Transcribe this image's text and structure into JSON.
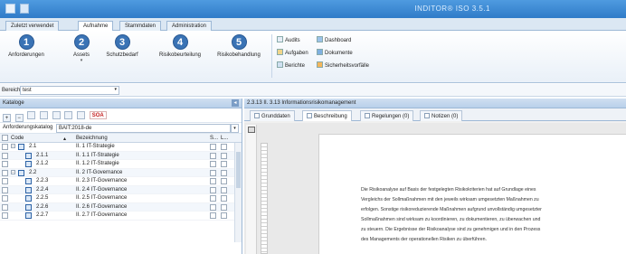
{
  "app": {
    "title": "INDITOR® ISO 3.5.1"
  },
  "ribbon_tabs": [
    {
      "label": "Zuletzt verwendet",
      "active": false
    },
    {
      "label": "Aufnahme",
      "active": true
    },
    {
      "label": "Stammdaten",
      "active": false
    },
    {
      "label": "Administration",
      "active": false
    }
  ],
  "ribbon": {
    "steps": [
      {
        "number": "1",
        "label": "Anforderungen"
      },
      {
        "number": "2",
        "label": "Assets"
      },
      {
        "number": "3",
        "label": "Schutzbedarf"
      },
      {
        "number": "4",
        "label": "Risikobeurteilung"
      },
      {
        "number": "5",
        "label": "Risikobehandlung"
      }
    ],
    "links_col1": [
      "Audits",
      "Aufgaben",
      "Berichte"
    ],
    "links_col2": [
      "Dashboard",
      "Dokumente",
      "Sicherheitsvorfälle"
    ],
    "accent_color": "#3a73b5"
  },
  "bereich": {
    "label": "Bereich",
    "value": "test"
  },
  "kataloge": {
    "title": "Kataloge",
    "soa_label": "SOA",
    "katalog_label": "Anforderungskatalog",
    "katalog_value": "BAIT:2018-de",
    "columns": {
      "code": "Code",
      "bezeichnung": "Bezeichnung",
      "s": "S...",
      "l": "L..."
    },
    "rows": [
      {
        "code": "2.1",
        "name": "II. 1 IT-Strategie",
        "level": 0
      },
      {
        "code": "2.1.1",
        "name": "II. 1.1 IT-Strategie",
        "level": 1
      },
      {
        "code": "2.1.2",
        "name": "II. 1.2 IT-Strategie",
        "level": 1
      },
      {
        "code": "2.2",
        "name": "II. 2 IT-Governance",
        "level": 0
      },
      {
        "code": "2.2.3",
        "name": "II. 2.3 IT-Governance",
        "level": 1
      },
      {
        "code": "2.2.4",
        "name": "II. 2.4 IT-Governance",
        "level": 1
      },
      {
        "code": "2.2.5",
        "name": "II. 2.5 IT-Governance",
        "level": 1
      },
      {
        "code": "2.2.6",
        "name": "II. 2.6 IT-Governance",
        "level": 1
      },
      {
        "code": "2.2.7",
        "name": "II. 2.7 IT-Governance",
        "level": 1
      }
    ]
  },
  "detail": {
    "title": "2.3.13 II. 3.13 Informationsrisikomanagement",
    "tabs": [
      {
        "label": "Grunddaten",
        "active": false
      },
      {
        "label": "Beschreibung",
        "active": true
      },
      {
        "label": "Regelungen (0)",
        "active": false
      },
      {
        "label": "Notizen (0)",
        "active": false
      }
    ],
    "body_lines": [
      "Die Risikoanalyse auf Basis der festgelegten Risikokriterien hat auf Grundlage eines",
      "Vergleichs der Sollmaßnahmen mit den jeweils wirksam umgesetzten Maßnahmen zu",
      "erfolgen. Sonstige risikoreduzierende Maßnahmen aufgrund unvollständig umgesetzter",
      "Sollmaßnahmen sind wirksam zu koordinieren, zu dokumentieren, zu überwachen und",
      "zu steuern. Die Ergebnisse der Risikoanalyse sind zu genehmigen und in den Prozess",
      "des Managements der operationellen Risiken zu überführen."
    ]
  }
}
